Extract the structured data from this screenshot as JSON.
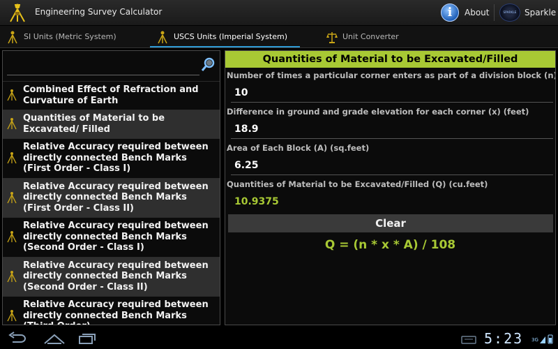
{
  "app": {
    "title": "Engineering Survey Calculator",
    "about_label": "About",
    "brand_label": "Sparkle",
    "brand_logo_text": "SPARKLE",
    "icon": "surveyor-icon"
  },
  "tabs": [
    {
      "label": "SI Units (Metric System)",
      "icon": "surveyor-icon",
      "selected": false
    },
    {
      "label": "USCS Units (Imperial System)",
      "icon": "surveyor-icon",
      "selected": true
    },
    {
      "label": "Unit Converter",
      "icon": "balance-scale-icon",
      "selected": false
    }
  ],
  "search": {
    "placeholder": "",
    "value": ""
  },
  "list": [
    {
      "label": "Combined Effect of Refraction and Curvature of Earth"
    },
    {
      "label": "Quantities of Material to be Excavated/ Filled"
    },
    {
      "label": "Relative Accuracy required between directly connected Bench Marks (First Order - Class I)"
    },
    {
      "label": "Relative Accuracy required between directly connected Bench Marks (First Order - Class II)"
    },
    {
      "label": "Relative Accuracy required between directly connected Bench Marks (Second Order - Class I)"
    },
    {
      "label": "Relative Accuracy required between directly connected Bench Marks (Second Order - Class II)"
    },
    {
      "label": "Relative Accuracy required between directly connected Bench Marks (Third Order)"
    }
  ],
  "form": {
    "title": "Quantities of Material to be Excavated/Filled",
    "fields": [
      {
        "label": "Number of times a particular corner enters as part of a division block (n)",
        "value": "10"
      },
      {
        "label": "Difference in ground and grade elevation for each corner (x) (feet)",
        "value": "18.9"
      },
      {
        "label": "Area of Each Block (A) (sq.feet)",
        "value": "6.25"
      }
    ],
    "result": {
      "label": "Quantities of Material to be Excavated/Filled (Q) (cu.feet)",
      "value": "10.9375"
    },
    "clear_label": "Clear",
    "formula": "Q = (n * x * A) / 108"
  },
  "status": {
    "time": "5:23",
    "network": "3G"
  },
  "colors": {
    "accent": "#a8c934",
    "tab_indicator": "#2f9bd6"
  }
}
